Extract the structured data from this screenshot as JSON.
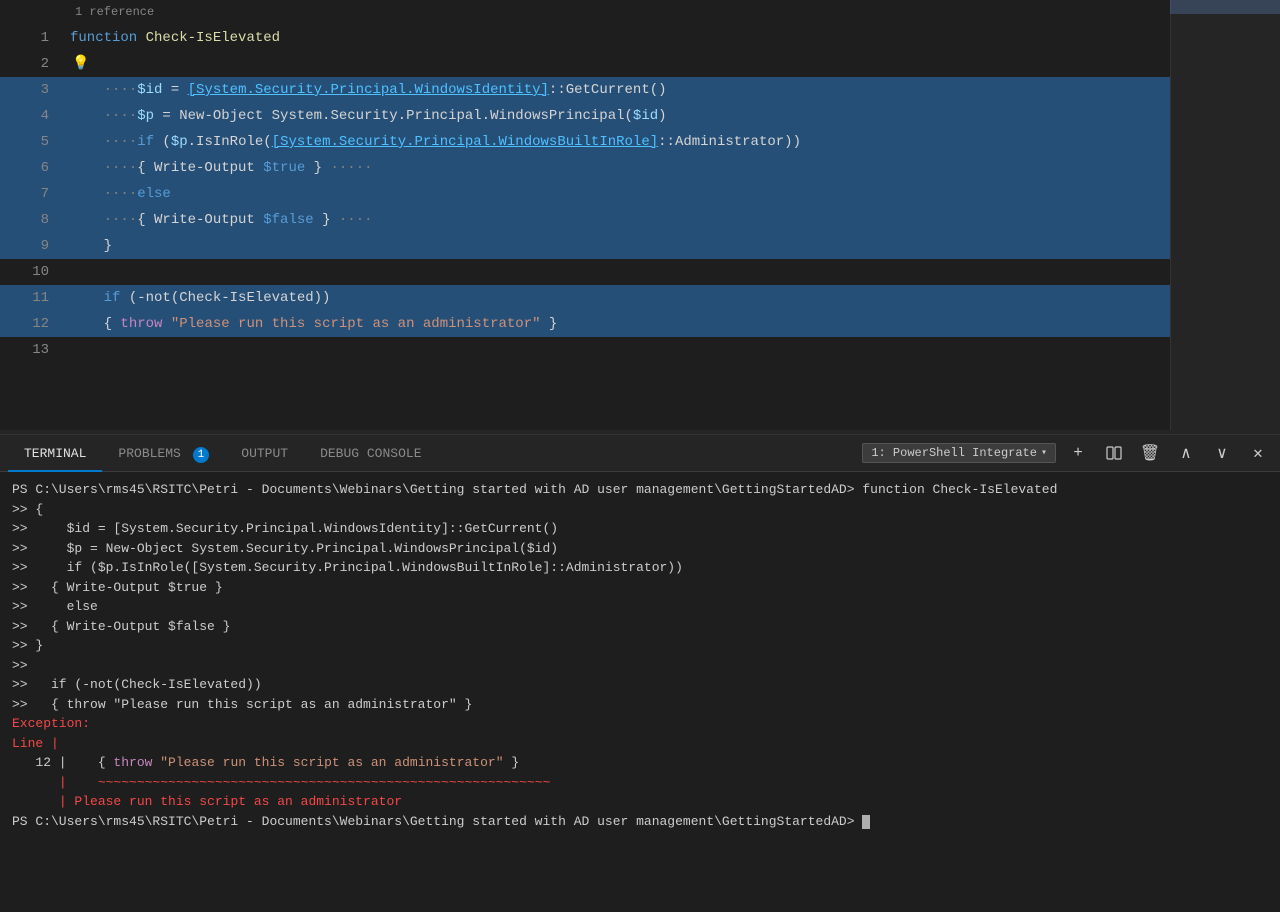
{
  "editor": {
    "reference_hint": "1 reference",
    "lines": [
      {
        "number": "1",
        "content_type": "function_def"
      },
      {
        "number": "2",
        "content_type": "empty_bulb"
      },
      {
        "number": "3",
        "content_type": "line3"
      },
      {
        "number": "4",
        "content_type": "line4"
      },
      {
        "number": "5",
        "content_type": "line5"
      },
      {
        "number": "6",
        "content_type": "line6"
      },
      {
        "number": "7",
        "content_type": "line7"
      },
      {
        "number": "8",
        "content_type": "line8"
      },
      {
        "number": "9",
        "content_type": "line9"
      },
      {
        "number": "10",
        "content_type": "empty"
      },
      {
        "number": "11",
        "content_type": "line11"
      },
      {
        "number": "12",
        "content_type": "line12"
      },
      {
        "number": "13",
        "content_type": "empty"
      }
    ]
  },
  "terminal": {
    "tabs": [
      {
        "id": "terminal",
        "label": "TERMINAL",
        "active": true
      },
      {
        "id": "problems",
        "label": "PROBLEMS",
        "badge": "1"
      },
      {
        "id": "output",
        "label": "OUTPUT"
      },
      {
        "id": "debug",
        "label": "DEBUG CONSOLE"
      }
    ],
    "shell_label": "1: PowerShell Integrate",
    "content_lines": [
      "PS C:\\Users\\rms45\\RSITC\\Petri - Documents\\Webinars\\Getting started with AD user management\\GettingStartedAD> function Check-IsElevated",
      "  {",
      "    $id = [System.Security.Principal.WindowsIdentity]::GetCurrent()",
      "    $p = New-Object System.Security.Principal.WindowsPrincipal($id)",
      "    if ($p.IsInRole([System.Security.Principal.WindowsBuiltInRole]::Administrator))",
      "  { Write-Output $true }",
      "    else",
      "  { Write-Output $false }",
      "  }",
      "",
      "  if (-not(Check-IsElevated))",
      "  { throw \"Please run this script as an administrator\" }",
      "Exception:",
      "Line |",
      "   12 |    { throw \"Please run this script as an administrator\" }",
      "      |    ~~~~~~~~~~~~~~~~~~~~~~~~~~~~~~~~~~~~~~~~~~~~~~~~~~~~~~~~~~",
      "      | Please run this script as an administrator",
      "PS C:\\Users\\rms45\\RSITC\\Petri - Documents\\Webinars\\Getting started with AD user management\\GettingStartedAD> "
    ]
  }
}
